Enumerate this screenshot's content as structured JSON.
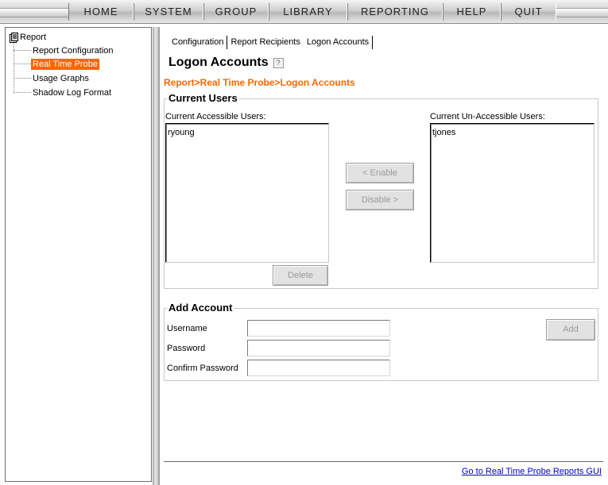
{
  "nav": {
    "items": [
      "HOME",
      "SYSTEM",
      "GROUP",
      "LIBRARY",
      "REPORTING",
      "HELP",
      "QUIT"
    ]
  },
  "tree": {
    "root": "Report",
    "items": [
      "Report Configuration",
      "Real Time Probe",
      "Usage Graphs",
      "Shadow Log Format"
    ],
    "selected_index": 1,
    "selected_color": "#ff6600"
  },
  "tabs": [
    "Configuration",
    "Report Recipients",
    "Logon Accounts"
  ],
  "page": {
    "title": "Logon Accounts",
    "help_icon": "question-icon",
    "breadcrumb": "Report>Real Time Probe>Logon Accounts",
    "accent_color": "#ff6600"
  },
  "current_users": {
    "legend": "Current Users",
    "accessible_label": "Current Accessible Users:",
    "accessible_users": [
      "ryoung"
    ],
    "unaccessible_label": "Current Un-Accessible Users:",
    "unaccessible_users": [
      "tjones"
    ],
    "enable_button": "< Enable",
    "disable_button": "Disable >",
    "delete_button": "Delete"
  },
  "add_account": {
    "legend": "Add Account",
    "username_label": "Username",
    "password_label": "Password",
    "confirm_label": "Confirm Password",
    "username_value": "",
    "password_value": "",
    "confirm_value": "",
    "add_button": "Add"
  },
  "footer": {
    "link": "Go to Real Time Probe Reports GUI"
  }
}
